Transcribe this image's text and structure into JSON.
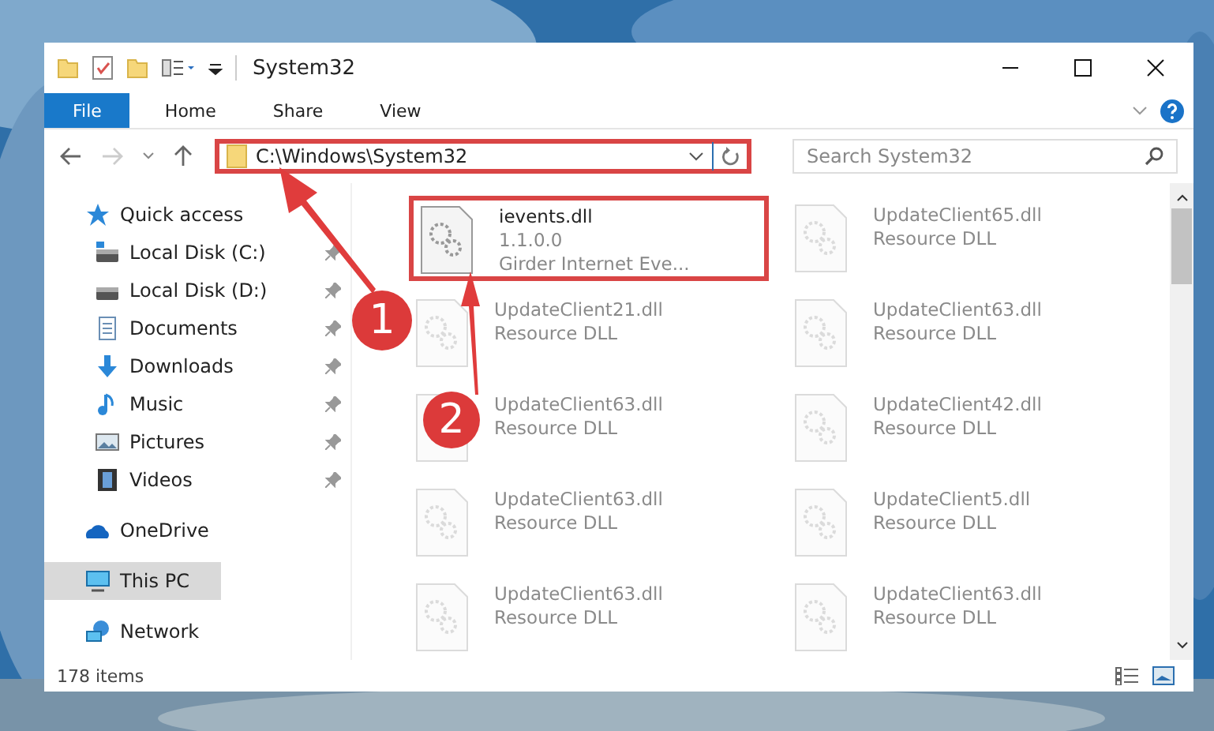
{
  "window": {
    "title": "System32"
  },
  "ribbon": {
    "tabs": [
      {
        "label": "File",
        "selected": true
      },
      {
        "label": "Home",
        "selected": false
      },
      {
        "label": "Share",
        "selected": false
      },
      {
        "label": "View",
        "selected": false
      }
    ]
  },
  "address_bar": {
    "value": "C:\\Windows\\System32"
  },
  "search": {
    "placeholder": "Search System32"
  },
  "sidebar": {
    "items": [
      {
        "label": "Quick access",
        "kind": "star",
        "selected": false,
        "children": [
          {
            "label": "Local Disk (C:)",
            "kind": "disk-c",
            "pinned": true,
            "selected": false
          },
          {
            "label": "Local Disk (D:)",
            "kind": "disk",
            "pinned": true,
            "selected": false
          },
          {
            "label": "Documents",
            "kind": "docs",
            "pinned": true,
            "selected": false
          },
          {
            "label": "Downloads",
            "kind": "down",
            "pinned": true,
            "selected": false
          },
          {
            "label": "Music",
            "kind": "music",
            "pinned": true,
            "selected": false
          },
          {
            "label": "Pictures",
            "kind": "pics",
            "pinned": true,
            "selected": false
          },
          {
            "label": "Videos",
            "kind": "video",
            "pinned": true,
            "selected": false
          }
        ]
      },
      {
        "label": "OneDrive",
        "kind": "cloud",
        "selected": false
      },
      {
        "label": "This PC",
        "kind": "pc",
        "selected": true
      },
      {
        "label": "Network",
        "kind": "net",
        "selected": false
      }
    ]
  },
  "files": [
    {
      "name": "ievents.dll",
      "version": "1.1.0.0",
      "description": "Girder Internet Eve...",
      "highlighted": true
    },
    {
      "name": "UpdateClient21.dll",
      "description": "Resource DLL",
      "highlighted": false
    },
    {
      "name": "UpdateClient63.dll",
      "description": "Resource DLL",
      "highlighted": false
    },
    {
      "name": "UpdateClient63.dll",
      "description": "Resource DLL",
      "highlighted": false
    },
    {
      "name": "UpdateClient63.dll",
      "description": "Resource DLL",
      "highlighted": false
    },
    {
      "name": "UpdateClient65.dll",
      "description": "Resource DLL",
      "highlighted": false
    },
    {
      "name": "UpdateClient63.dll",
      "description": "Resource DLL",
      "highlighted": false
    },
    {
      "name": "UpdateClient42.dll",
      "description": "Resource DLL",
      "highlighted": false
    },
    {
      "name": "UpdateClient5.dll",
      "description": "Resource DLL",
      "highlighted": false
    },
    {
      "name": "UpdateClient63.dll",
      "description": "Resource DLL",
      "highlighted": false
    }
  ],
  "status_bar": {
    "text": "178 items"
  },
  "annotations": [
    {
      "label": "1"
    },
    {
      "label": "2"
    }
  ]
}
